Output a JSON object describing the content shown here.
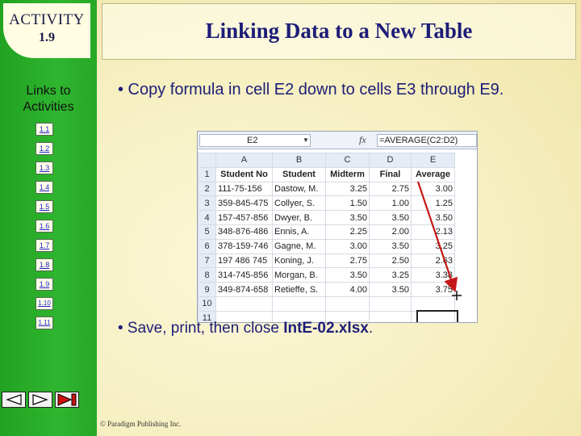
{
  "sidebar": {
    "badge_line1": "ACTIVITY",
    "badge_line2": "1.9",
    "links_heading": "Links to Activities",
    "links": [
      "1.1",
      "1.2",
      "1.3",
      "1.4",
      "1.5",
      "1.6",
      "1.7",
      "1.8",
      "1.9",
      "1.10",
      "1.11"
    ]
  },
  "nav_buttons": [
    "previous-slide",
    "next-slide",
    "last-slide"
  ],
  "title": "Linking Data to a New Table",
  "bullets": {
    "first": "• Copy formula in cell E2 down to cells E3 through E9.",
    "second_prefix": "• Save, print, then close ",
    "second_file": "IntE-02.xlsx",
    "second_suffix": "."
  },
  "copyright": "© Paradigm Publishing Inc.",
  "spreadsheet": {
    "name_box": "E2",
    "fx": "fx",
    "formula": "=AVERAGE(C2:D2)",
    "columns": [
      "",
      "A",
      "B",
      "C",
      "D",
      "E"
    ],
    "rows": [
      [
        "1",
        "Student No",
        "Student",
        "Midterm",
        "Final",
        "Average"
      ],
      [
        "2",
        "111-75-156",
        "Dastow, M.",
        "3.25",
        "2.75",
        "3.00"
      ],
      [
        "3",
        "359-845-475",
        "Collyer, S.",
        "1.50",
        "1.00",
        "1.25"
      ],
      [
        "4",
        "157-457-856",
        "Dwyer, B.",
        "3.50",
        "3.50",
        "3.50"
      ],
      [
        "5",
        "348-876-486",
        "Ennis, A.",
        "2.25",
        "2.00",
        "2.13"
      ],
      [
        "6",
        "378-159-746",
        "Gagne, M.",
        "3.00",
        "3.50",
        "3.25"
      ],
      [
        "7",
        "197 486 745",
        "Koning, J.",
        "2.75",
        "2.50",
        "2.63"
      ],
      [
        "8",
        "314-745-856",
        "Morgan, B.",
        "3.50",
        "3.25",
        "3.38"
      ],
      [
        "9",
        "349-874-658",
        "Retieffe, S.",
        "4.00",
        "3.50",
        "3.75"
      ],
      [
        "10",
        "",
        "",
        "",
        "",
        ""
      ],
      [
        "11",
        "",
        "",
        "",
        "",
        ""
      ]
    ]
  },
  "colors": {
    "sidebar_green": "#2fb52f",
    "title_text": "#1d1d78",
    "arrow": "#c41818"
  }
}
